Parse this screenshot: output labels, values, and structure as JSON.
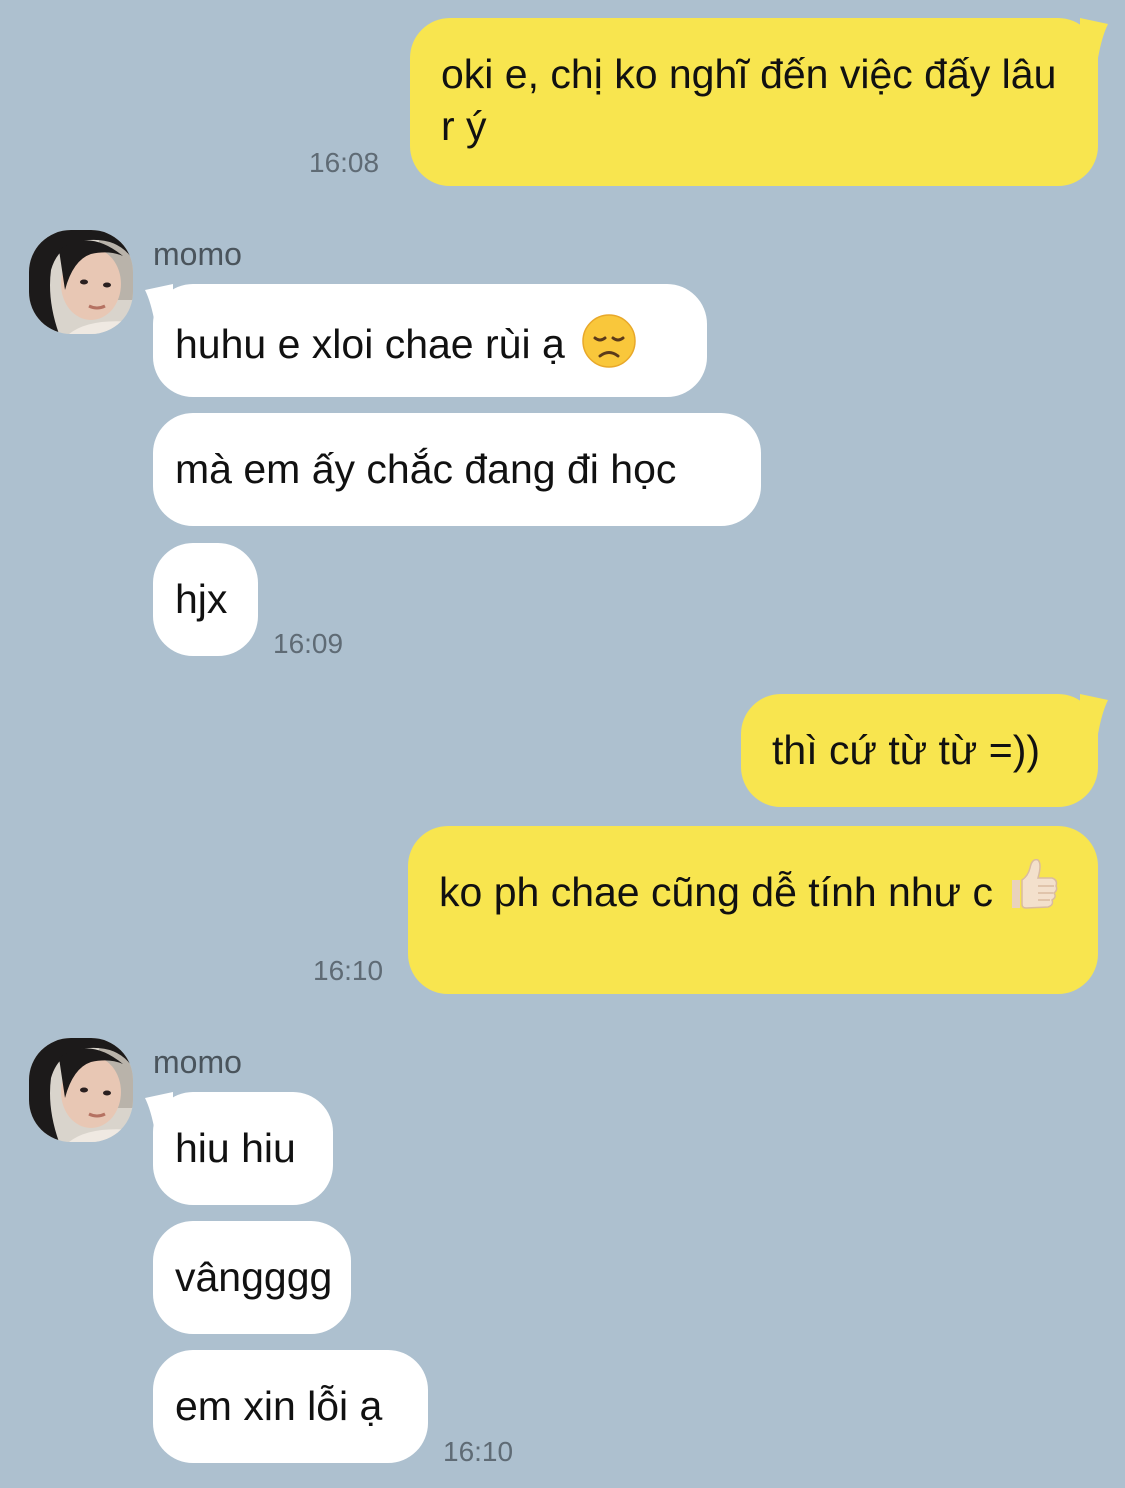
{
  "messages": [
    {
      "text": "oki e, chị ko nghĩ đến việc đấy lâu r ý",
      "time": "16:08"
    },
    {
      "sender": "momo",
      "text": "huhu e xloi chae rùi ạ",
      "emoji": "disappointed-face-icon"
    },
    {
      "text": "mà em ấy chắc đang đi học"
    },
    {
      "text": "hjx",
      "time": "16:09"
    },
    {
      "text": "thì cứ từ từ =))"
    },
    {
      "text": "ko ph chae cũng dễ tính như c",
      "emoji": "thumbs-up-icon",
      "time": "16:10"
    },
    {
      "sender": "momo",
      "text": "hiu hiu"
    },
    {
      "text": "vângggg"
    },
    {
      "text": "em xin lỗi ạ",
      "time": "16:10"
    }
  ],
  "colors": {
    "background": "#adc0cf",
    "outgoing_bubble": "#f8e54f",
    "incoming_bubble": "#ffffff",
    "timestamp": "#5f6b75"
  }
}
